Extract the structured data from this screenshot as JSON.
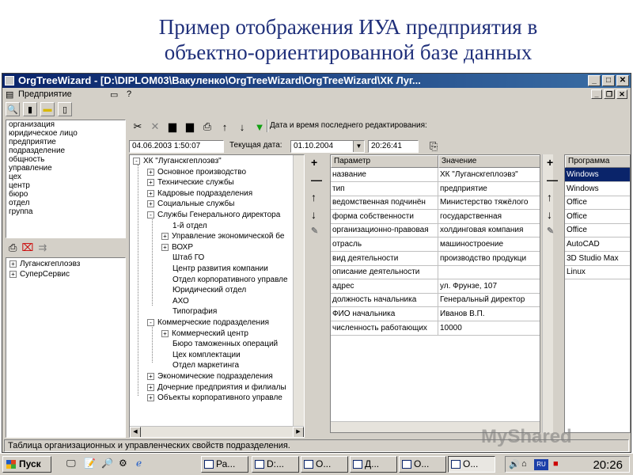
{
  "slide": {
    "title_line1": "Пример отображения ИУА предприятия в",
    "title_line2": "объектно-ориентированной базе данных"
  },
  "window": {
    "title": "OrgTreeWizard - [D:\\DIPLOM03\\Вакуленко\\OrgTreeWizard\\OrgTreeWizard\\ХК Луг...",
    "controls": {
      "minimize": "_",
      "maximize": "□",
      "close": "✕"
    }
  },
  "menu": {
    "items": [
      "Предприятие",
      "?"
    ]
  },
  "categories": [
    "организация",
    "юридическое лицо",
    "предприятие",
    "подразделение",
    "общность",
    "управление",
    "цех",
    "центр",
    "бюро",
    "отдел",
    "группа"
  ],
  "orgs": [
    {
      "sign": "+",
      "label": "Луганскгеплоэвз"
    },
    {
      "sign": "+",
      "label": "СуперСервис"
    }
  ],
  "toolbar": {
    "last_edit_label": "Дата и время последнего редактирования:"
  },
  "dates": {
    "last_edit_value": "04.06.2003 1:50:07",
    "current_date_label": "Текущая дата:",
    "current_date_value": "01.10.2004",
    "current_time_value": "20:26:41"
  },
  "tree": {
    "root": "ХК \"Луганскгеплоэвз\"",
    "nodes": [
      {
        "sign": "+",
        "label": "Основное производство",
        "level": 1
      },
      {
        "sign": "+",
        "label": "Технические службы",
        "level": 1
      },
      {
        "sign": "+",
        "label": "Кадровые подразделения",
        "level": 1
      },
      {
        "sign": "+",
        "label": "Социальные службы",
        "level": 1
      },
      {
        "sign": "-",
        "label": "Службы Генерального директора",
        "level": 1
      },
      {
        "sign": "",
        "label": "1-й отдел",
        "level": 2
      },
      {
        "sign": "+",
        "label": "Управление экономической бе",
        "level": 2
      },
      {
        "sign": "+",
        "label": "ВОХР",
        "level": 2
      },
      {
        "sign": "",
        "label": "Штаб ГО",
        "level": 2
      },
      {
        "sign": "",
        "label": "Центр развития компании",
        "level": 2
      },
      {
        "sign": "",
        "label": "Отдел корпоративного управле",
        "level": 2
      },
      {
        "sign": "",
        "label": "Юридический отдел",
        "level": 2
      },
      {
        "sign": "",
        "label": "АХО",
        "level": 2
      },
      {
        "sign": "",
        "label": "Типография",
        "level": 2
      },
      {
        "sign": "-",
        "label": "Коммерческие подразделения",
        "level": 1
      },
      {
        "sign": "+",
        "label": "Коммерческий центр",
        "level": 2
      },
      {
        "sign": "",
        "label": "Бюро таможенных операций",
        "level": 2
      },
      {
        "sign": "",
        "label": "Цех комплектации",
        "level": 2
      },
      {
        "sign": "",
        "label": "Отдел маркетинга",
        "level": 2
      },
      {
        "sign": "+",
        "label": "Экономические подразделения",
        "level": 1
      },
      {
        "sign": "+",
        "label": "Дочерние предприятия и филиалы",
        "level": 1
      },
      {
        "sign": "+",
        "label": "Объекты корпоративного управле",
        "level": 1
      }
    ]
  },
  "side_buttons": [
    "+",
    "—",
    "↑",
    "↓",
    "✎"
  ],
  "params": {
    "headers": [
      "Параметр",
      "Значение"
    ],
    "rows": [
      [
        "название",
        "ХК \"Луганскгеплоэвз\""
      ],
      [
        "тип",
        "предприятие"
      ],
      [
        "ведомственная подчинён",
        "Министерство тяжёлого"
      ],
      [
        "форма собственности",
        "государственная"
      ],
      [
        "организационно-правовая",
        "холдинговая компания"
      ],
      [
        "отрасль",
        "машиностроение"
      ],
      [
        "вид деятельности",
        "производство продукци"
      ],
      [
        "описание деятельности",
        ""
      ],
      [
        "адрес",
        "ул. Фрунзе, 107"
      ],
      [
        "должность начальника",
        "Генеральный директор"
      ],
      [
        "ФИО начальника",
        "Иванов В.П."
      ],
      [
        "численность работающих",
        "10000"
      ]
    ]
  },
  "programs": {
    "header": "Программа",
    "items": [
      "Windows",
      "Windows",
      "Office",
      "Office",
      "Office",
      "AutoCAD",
      "3D Studio Max",
      "Linux"
    ],
    "selected": 0
  },
  "status": "Таблица организационных и управленческих свойств подразделения.",
  "taskbar": {
    "start": "Пуск",
    "tasks": [
      "Ра...",
      "D:...",
      "О...",
      "Д...",
      "О...",
      "О..."
    ],
    "active_task": 5,
    "lang": "RU",
    "clock": "20:26"
  },
  "watermark": "MyShared",
  "colors": {
    "title_text": "#1f2f7a",
    "titlebar": "#0a246a",
    "selection": "#0a246a",
    "window_bg": "#d4d0c8"
  }
}
